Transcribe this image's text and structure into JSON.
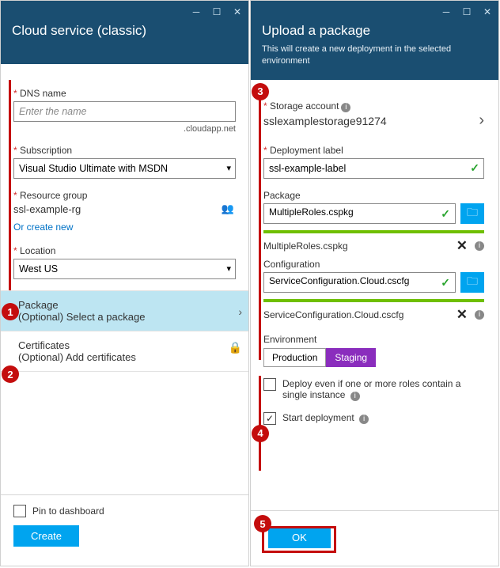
{
  "left": {
    "title": "Cloud service (classic)",
    "dns_label": "DNS name",
    "dns_placeholder": "Enter the name",
    "dns_suffix": ".cloudapp.net",
    "subscription_label": "Subscription",
    "subscription_value": "Visual Studio Ultimate with MSDN",
    "rg_label": "Resource group",
    "rg_value": "ssl-example-rg",
    "rg_create_link": "Or create new",
    "location_label": "Location",
    "location_value": "West US",
    "package_title": "Package",
    "package_sub": "(Optional) Select a package",
    "cert_title": "Certificates",
    "cert_sub": "(Optional) Add certificates",
    "pin_label": "Pin to dashboard",
    "create_btn": "Create"
  },
  "right": {
    "title": "Upload a package",
    "subtitle": "This will create a new deployment in the selected environment",
    "storage_label": "Storage account",
    "storage_value": "sslexamplestorage91274",
    "deploy_label_label": "Deployment label",
    "deploy_label_value": "ssl-example-label",
    "package_label": "Package",
    "package_value": "MultipleRoles.cspkg",
    "package_filename": "MultipleRoles.cspkg",
    "config_label": "Configuration",
    "config_value": "ServiceConfiguration.Cloud.cscfg",
    "config_filename": "ServiceConfiguration.Cloud.cscfg",
    "env_label": "Environment",
    "env_production": "Production",
    "env_staging": "Staging",
    "deploy_single_label": "Deploy even if one or more roles contain a single instance",
    "start_deploy_label": "Start deployment",
    "ok_btn": "OK"
  },
  "annotations": {
    "n1": "1",
    "n2": "2",
    "n3": "3",
    "n4": "4",
    "n5": "5"
  }
}
